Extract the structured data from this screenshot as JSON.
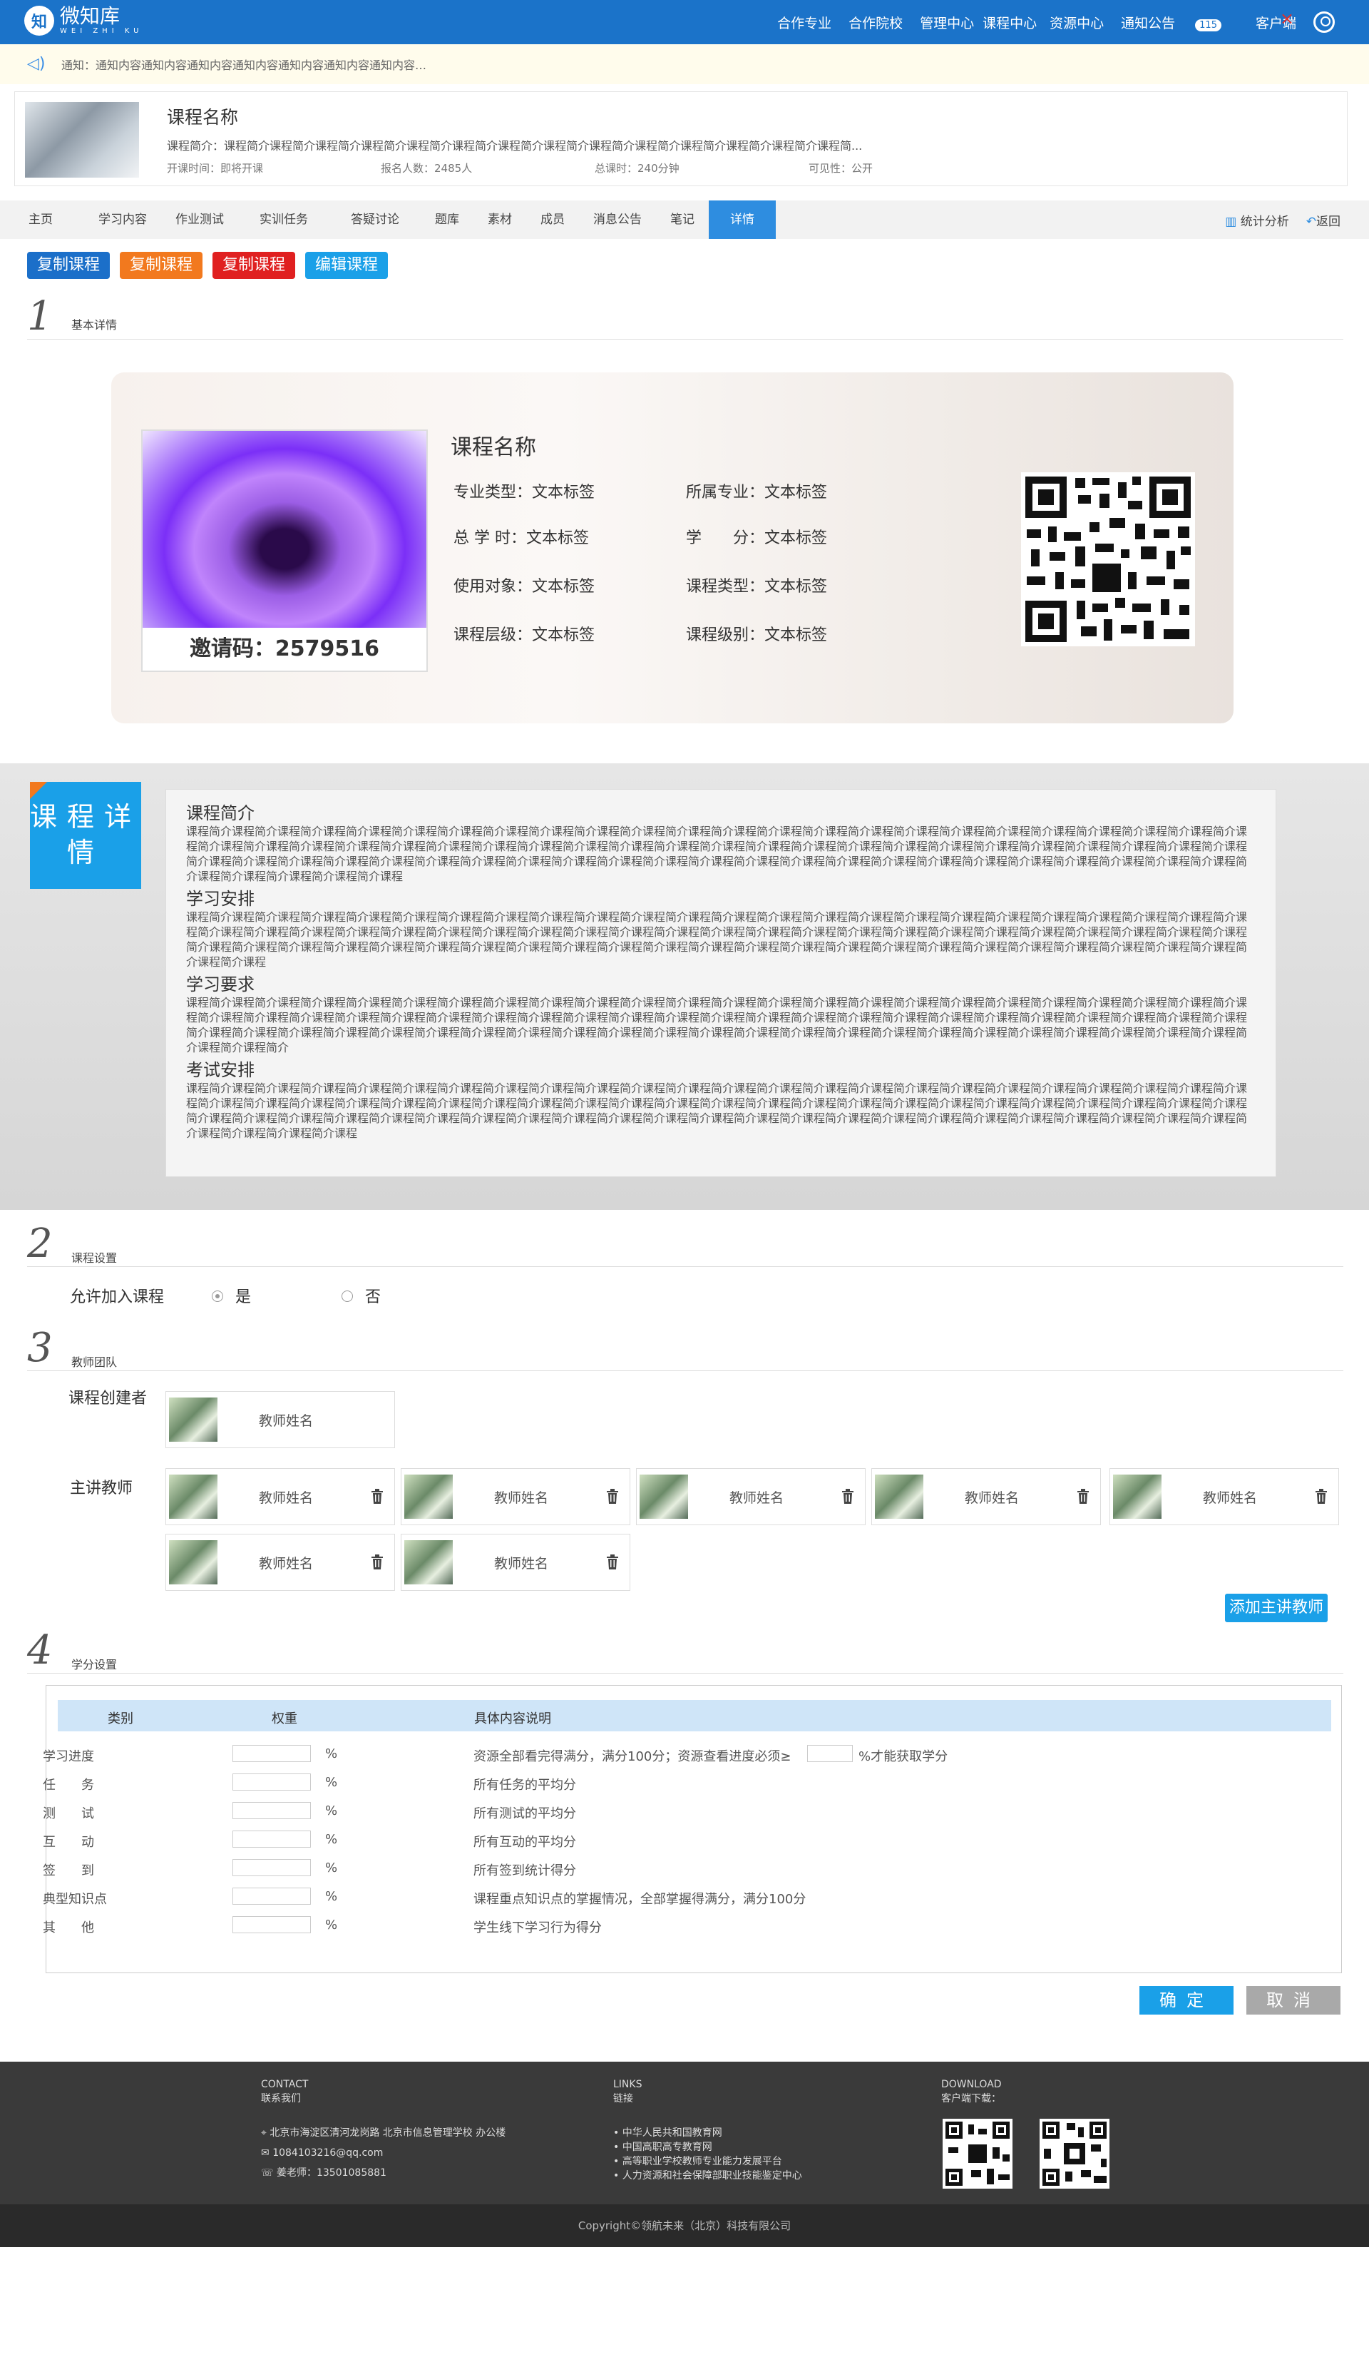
{
  "header": {
    "logo_text": "微知库",
    "logo_sub": "WEI ZHI KU",
    "nav": [
      "合作专业",
      "合作院校",
      "管理中心",
      "课程中心",
      "资源中心",
      "通知公告",
      "客户端"
    ],
    "notice_count": "115"
  },
  "notice": {
    "text": "通知：通知内容通知内容通知内容通知内容通知内容通知内容通知内容…"
  },
  "course": {
    "title": "课程名称",
    "intro": "课程简介：课程简介课程简介课程简介课程简介课程简介课程简介课程简介课程简介课程简介课程简介课程简介课程简介课程简介课程简...",
    "start": "开课时间：即将开课",
    "enroll": "报名人数：2485人",
    "hours": "总课时：240分钟",
    "visibility": "可见性：公开"
  },
  "tabs": [
    "主页",
    "学习内容",
    "作业测试",
    "实训任务",
    "答疑讨论",
    "题库",
    "素材",
    "成员",
    "消息公告",
    "笔记",
    "详情"
  ],
  "tab_right": {
    "stats": "统计分析",
    "back": "返回"
  },
  "actions": [
    {
      "label": "复制课程",
      "color": "#1b6fc9"
    },
    {
      "label": "复制课程",
      "color": "#f2791e"
    },
    {
      "label": "复制课程",
      "color": "#e02020"
    },
    {
      "label": "编辑课程",
      "color": "#1aa0e8"
    }
  ],
  "sections": {
    "s1": {
      "num": "1",
      "label": "基本详情"
    },
    "s2": {
      "num": "2",
      "label": "课程设置"
    },
    "s3": {
      "num": "3",
      "label": "教师团队"
    },
    "s4": {
      "num": "4",
      "label": "学分设置"
    }
  },
  "detail": {
    "title": "课程名称",
    "invite": "邀请码：2579516",
    "attrs": [
      [
        "专业类型：文本标签",
        "所属专业：文本标签"
      ],
      [
        "总 学 时：文本标签",
        "学　　分：文本标签"
      ],
      [
        "使用对象：文本标签",
        "课程类型：文本标签"
      ],
      [
        "课程层级：文本标签",
        "课程级别：文本标签"
      ]
    ]
  },
  "intro_box": {
    "label": "课程详情",
    "blocks": [
      {
        "title": "课程简介",
        "text": "课程简介课程简介课程简介课程简介课程简介课程简介课程简介课程简介课程简介课程简介课程简介课程简介课程简介课程简介课程简介课程简介课程简介课程简介课程简介课程简介课程简介课程简介课程简介课程简介课程简介课程简介课程简介课程简介课程简介课程简介课程简介课程简介课程简介课程简介课程简介课程简介课程简介课程简介课程简介课程简介课程简介课程简介课程简介课程简介课程简介课程简介课程简介课程简介课程简介课程简介课程简介课程简介课程简介课程简介课程简介课程简介课程简介课程简介课程简介课程简介课程简介课程简介课程简介课程简介课程简介课程简介课程简介课程简介课程简介课程简介课程简介课程简介课程简介课程简介课程"
      },
      {
        "title": "学习安排",
        "text": "课程简介课程简介课程简介课程简介课程简介课程简介课程简介课程简介课程简介课程简介课程简介课程简介课程简介课程简介课程简介课程简介课程简介课程简介课程简介课程简介课程简介课程简介课程简介课程简介课程简介课程简介课程简介课程简介课程简介课程简介课程简介课程简介课程简介课程简介课程简介课程简介课程简介课程简介课程简介课程简介课程简介课程简介课程简介课程简介课程简介课程简介课程简介课程简介课程简介课程简介课程简介课程简介课程简介课程简介课程简介课程简介课程简介课程简介课程简介课程简介课程简介课程简介课程简介课程简介课程简介课程简介课程简介课程简介课程简介课程简介课程简介课程"
      },
      {
        "title": "学习要求",
        "text": "课程简介课程简介课程简介课程简介课程简介课程简介课程简介课程简介课程简介课程简介课程简介课程简介课程简介课程简介课程简介课程简介课程简介课程简介课程简介课程简介课程简介课程简介课程简介课程简介课程简介课程简介课程简介课程简介课程简介课程简介课程简介课程简介课程简介课程简介课程简介课程简介课程简介课程简介课程简介课程简介课程简介课程简介课程简介课程简介课程简介课程简介课程简介课程简介课程简介课程简介课程简介课程简介课程简介课程简介课程简介课程简介课程简介课程简介课程简介课程简介课程简介课程简介课程简介课程简介课程简介课程简介课程简介课程简介课程简介课程简介课程简介课程简介"
      },
      {
        "title": "考试安排",
        "text": "课程简介课程简介课程简介课程简介课程简介课程简介课程简介课程简介课程简介课程简介课程简介课程简介课程简介课程简介课程简介课程简介课程简介课程简介课程简介课程简介课程简介课程简介课程简介课程简介课程简介课程简介课程简介课程简介课程简介课程简介课程简介课程简介课程简介课程简介课程简介课程简介课程简介课程简介课程简介课程简介课程简介课程简介课程简介课程简介课程简介课程简介课程简介课程简介课程简介课程简介课程简介课程简介课程简介课程简介课程简介课程简介课程简介课程简介课程简介课程简介课程简介课程简介课程简介课程简介课程简介课程简介课程简介课程简介课程简介课程简介课程简介课程简介课程简介课程"
      }
    ]
  },
  "settings": {
    "allow_label": "允许加入课程",
    "yes": "是",
    "no": "否",
    "selected": "是"
  },
  "teachers": {
    "creator_label": "课程创建者",
    "lecturer_label": "主讲教师",
    "creator_name": "教师姓名",
    "lecturers": [
      "教师姓名",
      "教师姓名",
      "教师姓名",
      "教师姓名",
      "教师姓名",
      "教师姓名",
      "教师姓名"
    ],
    "add_label": "添加主讲教师"
  },
  "credit": {
    "headers": [
      "类别",
      "权重",
      "具体内容说明"
    ],
    "rows": [
      {
        "cat": "学习进度",
        "unit": "%",
        "desc": "资源全部看完得满分，满分100分；资源查看进度必须≥",
        "desc2": "%才能获取学分"
      },
      {
        "cat": "任　　务",
        "unit": "%",
        "desc": "所有任务的平均分"
      },
      {
        "cat": "测　　试",
        "unit": "%",
        "desc": "所有测试的平均分"
      },
      {
        "cat": "互　　动",
        "unit": "%",
        "desc": "所有互动的平均分"
      },
      {
        "cat": "签　　到",
        "unit": "%",
        "desc": "所有签到统计得分"
      },
      {
        "cat": "典型知识点",
        "unit": "%",
        "desc": "课程重点知识点的掌握情况，全部掌握得满分，满分100分"
      },
      {
        "cat": "其　　他",
        "unit": "%",
        "desc": "学生线下学习行为得分"
      }
    ],
    "ok": "确定",
    "cancel": "取消"
  },
  "footer": {
    "contact_title": "CONTACT",
    "contact_sub": "联系我们",
    "address": "北京市海淀区清河龙岗路 北京市信息管理学校 办公楼",
    "email": "1084103216@qq.com",
    "teacher": "姜老师：13501085881",
    "links_title": "LINKS",
    "links_sub": "链接",
    "links": [
      "中华人民共和国教育网",
      "中国高职高专教育网",
      "高等职业学校教师专业能力发展平台",
      "人力资源和社会保障部职业技能鉴定中心"
    ],
    "download_title": "DOWNLOAD",
    "download_sub": "客户端下载：",
    "copyright": "Copyright©领航未来（北京）科技有限公司"
  }
}
